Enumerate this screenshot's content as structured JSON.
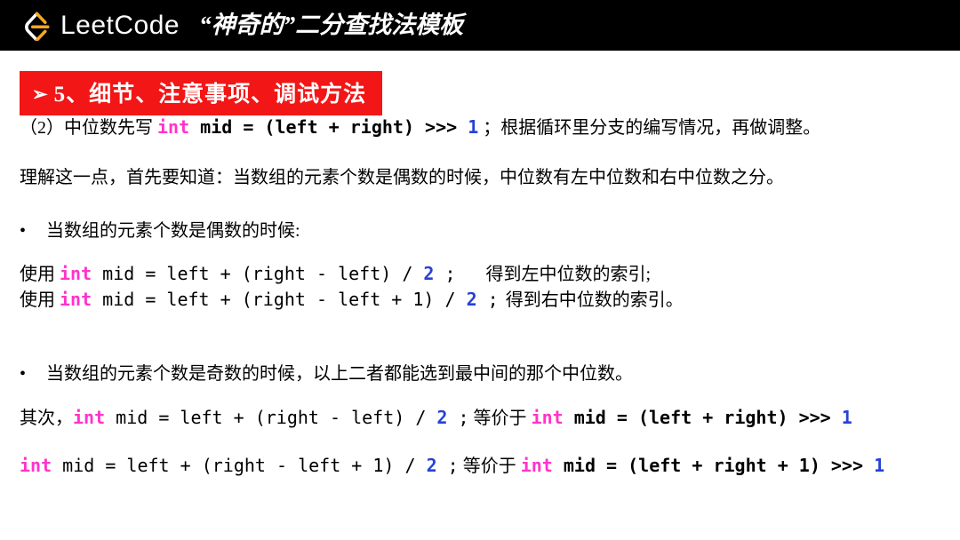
{
  "header": {
    "brand": "LeetCode",
    "title": "“神奇的”二分查找法模板",
    "logo_icon": "leetcode-logo-icon",
    "background_color": "#000000"
  },
  "section": {
    "arrow_icon": "➢",
    "title": "5、细节、注意事项、调试方法",
    "background_color": "#F21616",
    "text_color": "#FFFFFF"
  },
  "colors": {
    "keyword": "#FF33CC",
    "number": "#2642D6",
    "text": "#000000"
  },
  "content": {
    "para1": {
      "prefix": "（2）中位数先写 ",
      "code_kw": "int",
      "code_mid": " mid = (left + right) >>> ",
      "code_num": "1",
      "code_semicolon": " ；",
      "suffix": "根据循环里分支的编写情况，再做调整。"
    },
    "para2": "理解这一点，首先要知道：当数组的元素个数是偶数的时候，中位数有左中位数和右中位数之分。",
    "bullet1": {
      "marker": "•",
      "text": "当数组的元素个数是偶数的时候:"
    },
    "code_line1": {
      "prefix": "使用 ",
      "kw": "int",
      "mid": " mid = left + (right - left) / ",
      "num": "2",
      "semi": " ;",
      "comment": "得到左中位数的索引;"
    },
    "code_line2": {
      "prefix": "使用 ",
      "kw": "int",
      "mid": " mid = left + (right - left + 1) / ",
      "num": "2",
      "semi": " ;",
      "comment": "得到右中位数的索引。"
    },
    "bullet2": {
      "marker": "•",
      "text": "当数组的元素个数是奇数的时候，以上二者都能选到最中间的那个中位数。"
    },
    "code_line3": {
      "prefix": "其次，",
      "kw1": "int",
      "part1": " mid = left + (right - left) / ",
      "num1": "2",
      "semi1": " ;",
      "connector": " 等价于 ",
      "kw2": "int",
      "part2": " mid = (left + right) >>> ",
      "num2": "1"
    },
    "code_line4": {
      "kw1": "int",
      "part1": " mid = left + (right - left + 1) / ",
      "num1": "2",
      "semi1": " ;",
      "connector": " 等价于 ",
      "kw2": "int",
      "part2": " mid = (left + right + 1) >>> ",
      "num2": "1"
    }
  }
}
